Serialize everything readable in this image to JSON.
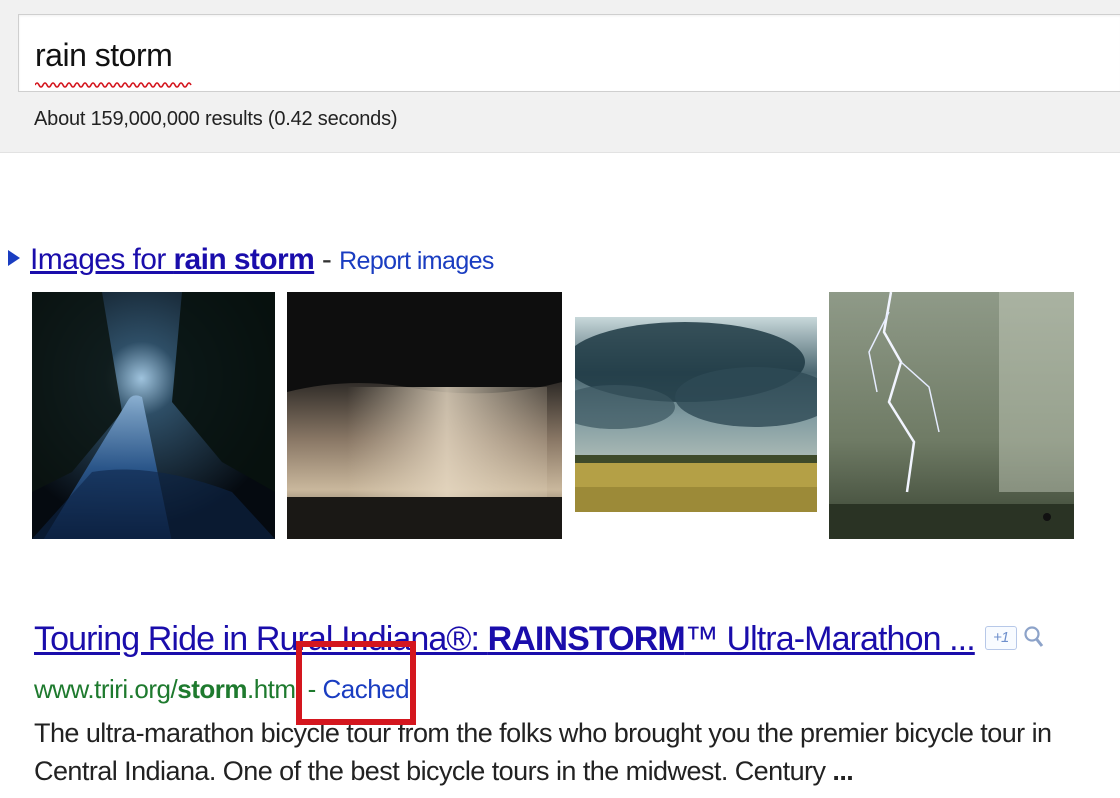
{
  "search": {
    "query": "rain storm",
    "stats": "About 159,000,000 results (0.42 seconds)"
  },
  "images_section": {
    "prefix": "Images for ",
    "query_bold": "rain storm",
    "separator": " - ",
    "report_label": "Report images",
    "icon": "triangle-right-icon",
    "thumbnails": [
      {
        "name": "dark-forest-road-rain"
      },
      {
        "name": "storm-cloud-rain-shaft"
      },
      {
        "name": "storm-clouds-over-field"
      },
      {
        "name": "lightning-over-water"
      }
    ]
  },
  "result": {
    "title_prefix": "Touring Ride in Rural Indiana®: ",
    "title_bold": "RAINSTORM",
    "title_suffix": "™ Ultra-Marathon ...",
    "plus_one_label": "+1",
    "preview_icon": "magnifier-icon",
    "url_prefix": "www.triri.org/",
    "url_bold": "storm",
    "url_suffix": ".html",
    "url_sep": " - ",
    "cached_label": "Cached",
    "snippet": "The ultra-marathon bicycle tour from the folks who brought you the premier bicycle tour in Central Indiana. One of the best bicycle tours in the midwest. Century ",
    "snippet_ellipsis": "..."
  },
  "colors": {
    "link": "#1a0dab",
    "url_green": "#1e7a2e",
    "highlight_red": "#d4161e"
  }
}
